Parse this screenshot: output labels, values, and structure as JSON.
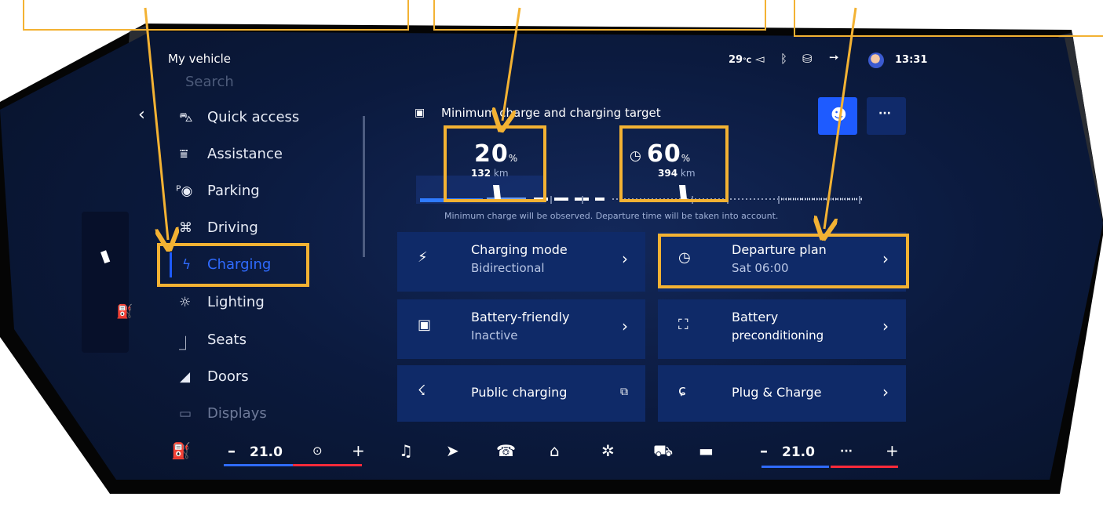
{
  "status_bar": {
    "title": "My vehicle",
    "temperature": "29",
    "temp_unit": "°C",
    "time": "13:31"
  },
  "menu": {
    "ghost_item": "Search",
    "items": [
      {
        "label": "Quick access"
      },
      {
        "label": "Assistance"
      },
      {
        "label": "Parking"
      },
      {
        "label": "Driving"
      },
      {
        "label": "Charging"
      },
      {
        "label": "Lighting"
      },
      {
        "label": "Seats"
      },
      {
        "label": "Doors"
      },
      {
        "label": "Displays"
      }
    ]
  },
  "charge": {
    "header": "Minimum charge and charging target",
    "min_value": "20",
    "min_unit": "%",
    "min_km": "132",
    "target_value": "60",
    "target_unit": "%",
    "target_km": "394",
    "km_unit": "km",
    "note": "Minimum charge will be observed. Departure time will be taken into account."
  },
  "cards": [
    {
      "title": "Charging mode",
      "sub": "Bidirectional"
    },
    {
      "title": "Departure plan",
      "sub": "Sat 06:00"
    },
    {
      "title": "Battery-friendly",
      "sub": "Inactive"
    },
    {
      "title": "Battery",
      "sub": "preconditioning"
    },
    {
      "title": "Public charging"
    },
    {
      "title": "Plug & Charge"
    }
  ],
  "climate": {
    "left_temp": "21.0",
    "right_temp": "21.0",
    "minus": "–",
    "plus": "+"
  },
  "more_label": "···",
  "colors": {
    "accent": "#f3b233",
    "panel": "#0f2a68",
    "selected": "#1e5bff",
    "bg": "#0b1a3e"
  }
}
